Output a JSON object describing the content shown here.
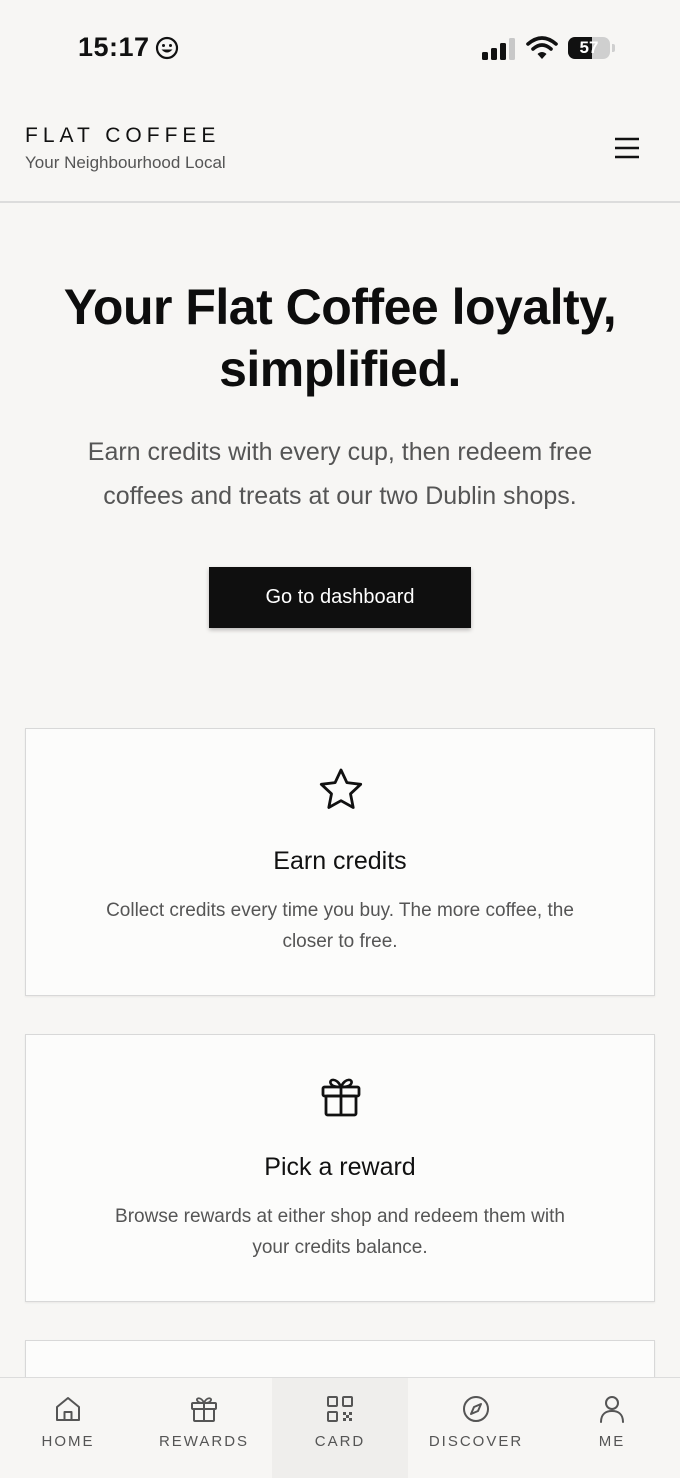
{
  "status_bar": {
    "time": "15:17",
    "battery": "57",
    "battery_level": 0.57
  },
  "header": {
    "brand": "FLAT COFFEE",
    "tagline": "Your Neighbourhood Local"
  },
  "hero": {
    "title_line1": "Your Flat Coffee loyalty,",
    "title_line2": "simplified.",
    "subtitle_line1": "Earn credits with every cup, then redeem free",
    "subtitle_line2": "coffees and treats at our two Dublin shops.",
    "cta_label": "Go to dashboard"
  },
  "cards": [
    {
      "icon": "star-icon",
      "title": "Earn credits",
      "text_line1": "Collect credits every time you buy. The more coffee, the",
      "text_line2": "closer to free."
    },
    {
      "icon": "gift-icon",
      "title": "Pick a reward",
      "text_line1": "Browse rewards at either shop and redeem them with",
      "text_line2": "your credits balance."
    }
  ],
  "bottom_nav": {
    "items": [
      {
        "label": "HOME",
        "icon": "home-icon"
      },
      {
        "label": "REWARDS",
        "icon": "gift-icon"
      },
      {
        "label": "CARD",
        "icon": "qr-code-icon"
      },
      {
        "label": "DISCOVER",
        "icon": "compass-icon"
      },
      {
        "label": "ME",
        "icon": "user-icon"
      }
    ],
    "active": "CARD"
  },
  "colors": {
    "background": "#f7f6f4",
    "card": "#fcfcfb",
    "button": "#0f0f0f",
    "text": "#111111",
    "muted": "#555555",
    "border": "#d8d8d8"
  }
}
